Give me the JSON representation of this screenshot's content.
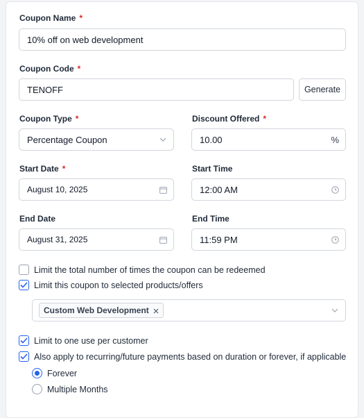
{
  "form": {
    "coupon_name": {
      "label": "Coupon Name",
      "required": "*",
      "value": "10% off on web development"
    },
    "coupon_code": {
      "label": "Coupon Code",
      "required": "*",
      "value": "TENOFF",
      "generate_label": "Generate"
    },
    "coupon_type": {
      "label": "Coupon Type",
      "required": "*",
      "value": "Percentage Coupon"
    },
    "discount": {
      "label": "Discount Offered",
      "required": "*",
      "value": "10.00",
      "suffix": "%"
    },
    "start_date": {
      "label": "Start Date",
      "required": "*",
      "value": "August 10, 2025"
    },
    "start_time": {
      "label": "Start Time",
      "value": "12:00 AM"
    },
    "end_date": {
      "label": "End Date",
      "value": "August 31, 2025"
    },
    "end_time": {
      "label": "End Time",
      "value": "11:59 PM"
    }
  },
  "options": {
    "limit_total": {
      "label": "Limit the total number of times the coupon can be redeemed",
      "checked": false
    },
    "limit_products": {
      "label": "Limit this coupon to selected products/offers",
      "checked": true
    },
    "products_select": {
      "tags": [
        "Custom Web Development"
      ]
    },
    "one_use": {
      "label": "Limit to one use per customer",
      "checked": true
    },
    "recurring": {
      "label": "Also apply to recurring/future payments based on duration or forever, if applicable",
      "checked": true
    },
    "duration": [
      {
        "label": "Forever",
        "selected": true
      },
      {
        "label": "Multiple Months",
        "selected": false
      }
    ]
  },
  "colors": {
    "accent": "#2563eb",
    "required": "#dc2626",
    "border": "#d1d5db"
  },
  "icons": {
    "calendar": "calendar-icon",
    "clock": "clock-icon",
    "chevron": "chevron-down-icon",
    "check": "check-icon",
    "remove": "close-icon"
  }
}
